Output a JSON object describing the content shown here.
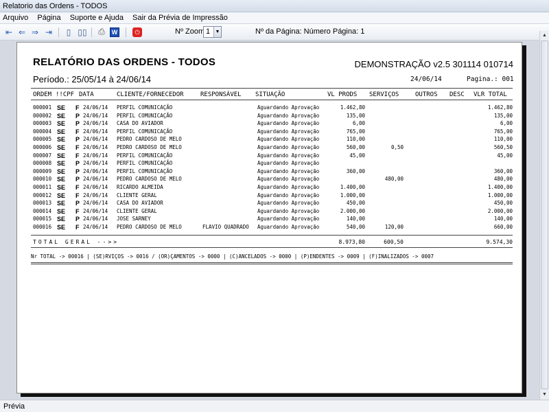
{
  "window": {
    "title": "Relatorio das Ordens - TODOS"
  },
  "menu": [
    "Arquivo",
    "Página",
    "Suporte e Ajuda",
    "Sair da Prévia de Impressão"
  ],
  "toolbar": {
    "zoom_label": "Nº Zoom",
    "zoom_value": "1",
    "page_label": "Nº da Página: Número Página: 1",
    "icons": [
      "first-page-icon",
      "prev-page-icon",
      "next-page-icon",
      "last-page-icon",
      "single-page-icon",
      "two-pages-icon",
      "print-icon",
      "word-export-icon",
      "exit-icon"
    ]
  },
  "report": {
    "title": "RELATÓRIO DAS ORDENS - TODOS",
    "version": "DEMONSTRAÇÃO v2.5 301114 010714",
    "period": "Período.: 25/05/14 à 24/06/14",
    "date": "24/06/14",
    "page": "Pagina.: 001",
    "columns": {
      "ordem": "ORDEM",
      "cpf": "!!CPF",
      "data": "DATA",
      "cliente": "CLIENTE/FORNECEDOR",
      "responsavel": "RESPONSÁVEL",
      "situacao": "SITUAÇÃO",
      "vl_prods": "VL PRODS",
      "servicos": "SERVIÇOS",
      "outros": "OUTROS",
      "desc": "DESC",
      "vlr_total": "VLR TOTAL"
    },
    "rows": [
      {
        "ordem": "000001",
        "se": "SE",
        "t": "F",
        "data": "24/06/14",
        "cliente": "PERFIL COMUNICAÇÃO",
        "responsavel": "",
        "situacao": "Aguardando Aprovação",
        "vl_prods": "1.462,80",
        "servicos": "",
        "vlr_total": "1.462,80"
      },
      {
        "ordem": "000002",
        "se": "SE",
        "t": "P",
        "data": "24/06/14",
        "cliente": "PERFIL COMUNICAÇÃO",
        "responsavel": "",
        "situacao": "Aguardando Aprovação",
        "vl_prods": "135,00",
        "servicos": "",
        "vlr_total": "135,00"
      },
      {
        "ordem": "000003",
        "se": "SE",
        "t": "P",
        "data": "24/06/14",
        "cliente": "CASA DO AVIADOR",
        "responsavel": "",
        "situacao": "Aguardando Aprovação",
        "vl_prods": "6,00",
        "servicos": "",
        "vlr_total": "6,00"
      },
      {
        "ordem": "000004",
        "se": "SE",
        "t": "F",
        "data": "24/06/14",
        "cliente": "PERFIL COMUNICAÇÃO",
        "responsavel": "",
        "situacao": "Aguardando Aprovação",
        "vl_prods": "765,00",
        "servicos": "",
        "vlr_total": "765,00"
      },
      {
        "ordem": "000005",
        "se": "SE",
        "t": "P",
        "data": "24/06/14",
        "cliente": "PEDRO CARDOSO DE MELO",
        "responsavel": "",
        "situacao": "Aguardando Aprovação",
        "vl_prods": "110,00",
        "servicos": "",
        "vlr_total": "110,00"
      },
      {
        "ordem": "000006",
        "se": "SE",
        "t": "F",
        "data": "24/06/14",
        "cliente": "PEDRO CARDOSO DE MELO",
        "responsavel": "",
        "situacao": "Aguardando Aprovação",
        "vl_prods": "560,00",
        "servicos": "0,50",
        "vlr_total": "560,50"
      },
      {
        "ordem": "000007",
        "se": "SE",
        "t": "F",
        "data": "24/06/14",
        "cliente": "PERFIL COMUNICAÇÃO",
        "responsavel": "",
        "situacao": "Aguardando Aprovação",
        "vl_prods": "45,00",
        "servicos": "",
        "vlr_total": "45,00"
      },
      {
        "ordem": "000008",
        "se": "SE",
        "t": "P",
        "data": "24/06/14",
        "cliente": "PERFIL COMUNICAÇÃO",
        "responsavel": "",
        "situacao": "Aguardando Aprovação",
        "vl_prods": "",
        "servicos": "",
        "vlr_total": ""
      },
      {
        "ordem": "000009",
        "se": "SE",
        "t": "P",
        "data": "24/06/14",
        "cliente": "PERFIL COMUNICAÇÃO",
        "responsavel": "",
        "situacao": "Aguardando Aprovação",
        "vl_prods": "360,00",
        "servicos": "",
        "vlr_total": "360,00"
      },
      {
        "ordem": "000010",
        "se": "SE",
        "t": "P",
        "data": "24/06/14",
        "cliente": "PEDRO CARDOSO DE MELO",
        "responsavel": "",
        "situacao": "Aguardando Aprovação",
        "vl_prods": "",
        "servicos": "480,00",
        "vlr_total": "480,00"
      },
      {
        "ordem": "000011",
        "se": "SE",
        "t": "F",
        "data": "24/06/14",
        "cliente": "RICARDO ALMEIDA",
        "responsavel": "",
        "situacao": "Aguardando Aprovação",
        "vl_prods": "1.400,00",
        "servicos": "",
        "vlr_total": "1.400,00"
      },
      {
        "ordem": "000012",
        "se": "SE",
        "t": "F",
        "data": "24/06/14",
        "cliente": "CLIENTE GERAL",
        "responsavel": "",
        "situacao": "Aguardando Aprovação",
        "vl_prods": "1.000,00",
        "servicos": "",
        "vlr_total": "1.000,00"
      },
      {
        "ordem": "000013",
        "se": "SE",
        "t": "P",
        "data": "24/06/14",
        "cliente": "CASA DO AVIADOR",
        "responsavel": "",
        "situacao": "Aguardando Aprovação",
        "vl_prods": "450,00",
        "servicos": "",
        "vlr_total": "450,00"
      },
      {
        "ordem": "000014",
        "se": "SE",
        "t": "F",
        "data": "24/06/14",
        "cliente": "CLIENTE GERAL",
        "responsavel": "",
        "situacao": "Aguardando Aprovação",
        "vl_prods": "2.000,00",
        "servicos": "",
        "vlr_total": "2.000,00"
      },
      {
        "ordem": "000015",
        "se": "SE",
        "t": "P",
        "data": "24/06/14",
        "cliente": "JOSE SARNEY",
        "responsavel": "",
        "situacao": "Aguardando Aprovação",
        "vl_prods": "140,00",
        "servicos": "",
        "vlr_total": "140,00"
      },
      {
        "ordem": "000016",
        "se": "SE",
        "t": "F",
        "data": "24/06/14",
        "cliente": "PEDRO CARDOSO DE MELO",
        "responsavel": "FLAVIO QUADRADO",
        "situacao": "Aguardando Aprovação",
        "vl_prods": "540,00",
        "servicos": "120,00",
        "vlr_total": "660,00"
      }
    ],
    "total": {
      "label": "TOTAL GERAL -->>",
      "vl_prods": "8.973,80",
      "servicos": "600,50",
      "vlr_total": "9.574,30"
    },
    "summary": "Nr TOTAL -> 00016 | (SE)RVIÇOS -> 0016 / (OR)ÇAMENTOS -> 0000 | (C)ANCELADOS -> 0000 | (P)ENDENTES -> 0009 | (F)INALIZADOS -> 0007"
  },
  "status": {
    "text": "Prévia"
  }
}
